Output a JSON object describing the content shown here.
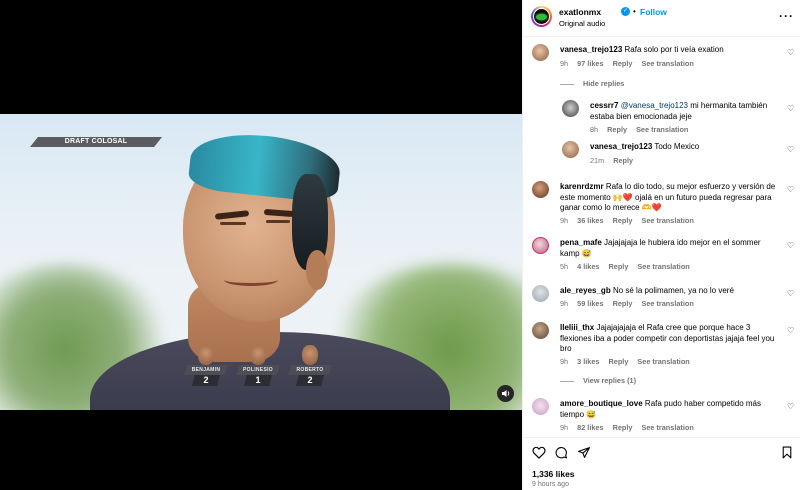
{
  "video": {
    "banner": "DRAFT COLOSAL",
    "contestants": [
      {
        "name": "BENJAMIN",
        "number": "2"
      },
      {
        "name": "POLINESIO",
        "number": "1"
      },
      {
        "name": "ROBERTO",
        "number": "2"
      }
    ],
    "mute_icon": "speaker-icon"
  },
  "header": {
    "username": "exatlonmx",
    "follow": "Follow",
    "audio": "Original audio",
    "separator": "•"
  },
  "comments": [
    {
      "user": "vanesa_trejo123",
      "text": "Rafa solo por ti veía exation",
      "age": "9h",
      "likes": "97 likes",
      "reply": "Reply",
      "translate": "See translation"
    },
    {
      "toggle": "Hide replies"
    },
    {
      "user": "cessrr7",
      "mention": "@vanesa_trejo123",
      "text": "mi hermanita también estaba bien emocionada jeje",
      "age": "8h",
      "reply": "Reply",
      "translate": "See translation"
    },
    {
      "user": "vanesa_trejo123",
      "text": "Todo Mexico",
      "age": "21m",
      "reply": "Reply"
    },
    {
      "user": "karenrdzmr",
      "text": "Rafa lo dio todo, su mejor esfuerzo y versión de este momento 🙌❤️ ojalá en un futuro pueda regresar para ganar como lo merece 🫶❤️",
      "age": "9h",
      "likes": "36 likes",
      "reply": "Reply",
      "translate": "See translation"
    },
    {
      "user": "pena_mafe",
      "text": "Jajajajaja le hubiera ido mejor en el sommer kamp 😅",
      "age": "5h",
      "likes": "4 likes",
      "reply": "Reply",
      "translate": "See translation"
    },
    {
      "user": "ale_reyes_gb",
      "text": "No sé la polimamen, ya no lo veré",
      "age": "9h",
      "likes": "59 likes",
      "reply": "Reply",
      "translate": "See translation"
    },
    {
      "user": "lleliii_thx",
      "text": "Jajajajajaja el Rafa cree que porque hace 3 flexiones iba a poder competir con deportistas jajaja feel you bro",
      "age": "9h",
      "likes": "3 likes",
      "reply": "Reply",
      "translate": "See translation"
    },
    {
      "toggle": "View replies (1)"
    },
    {
      "user": "amore_boutique_love",
      "text": "Rafa pudo haber competido más tiempo 😅",
      "age": "9h",
      "likes": "82 likes",
      "reply": "Reply",
      "translate": "See translation"
    }
  ],
  "footer": {
    "likes": "1,336 likes",
    "time": "9 hours ago",
    "icons": [
      "heart-icon",
      "comment-icon",
      "share-icon",
      "bookmark-icon"
    ]
  },
  "colors": {
    "accent": "#0095f6",
    "muted_text": "#737373",
    "mention": "#00376b",
    "divider": "#efefef"
  }
}
